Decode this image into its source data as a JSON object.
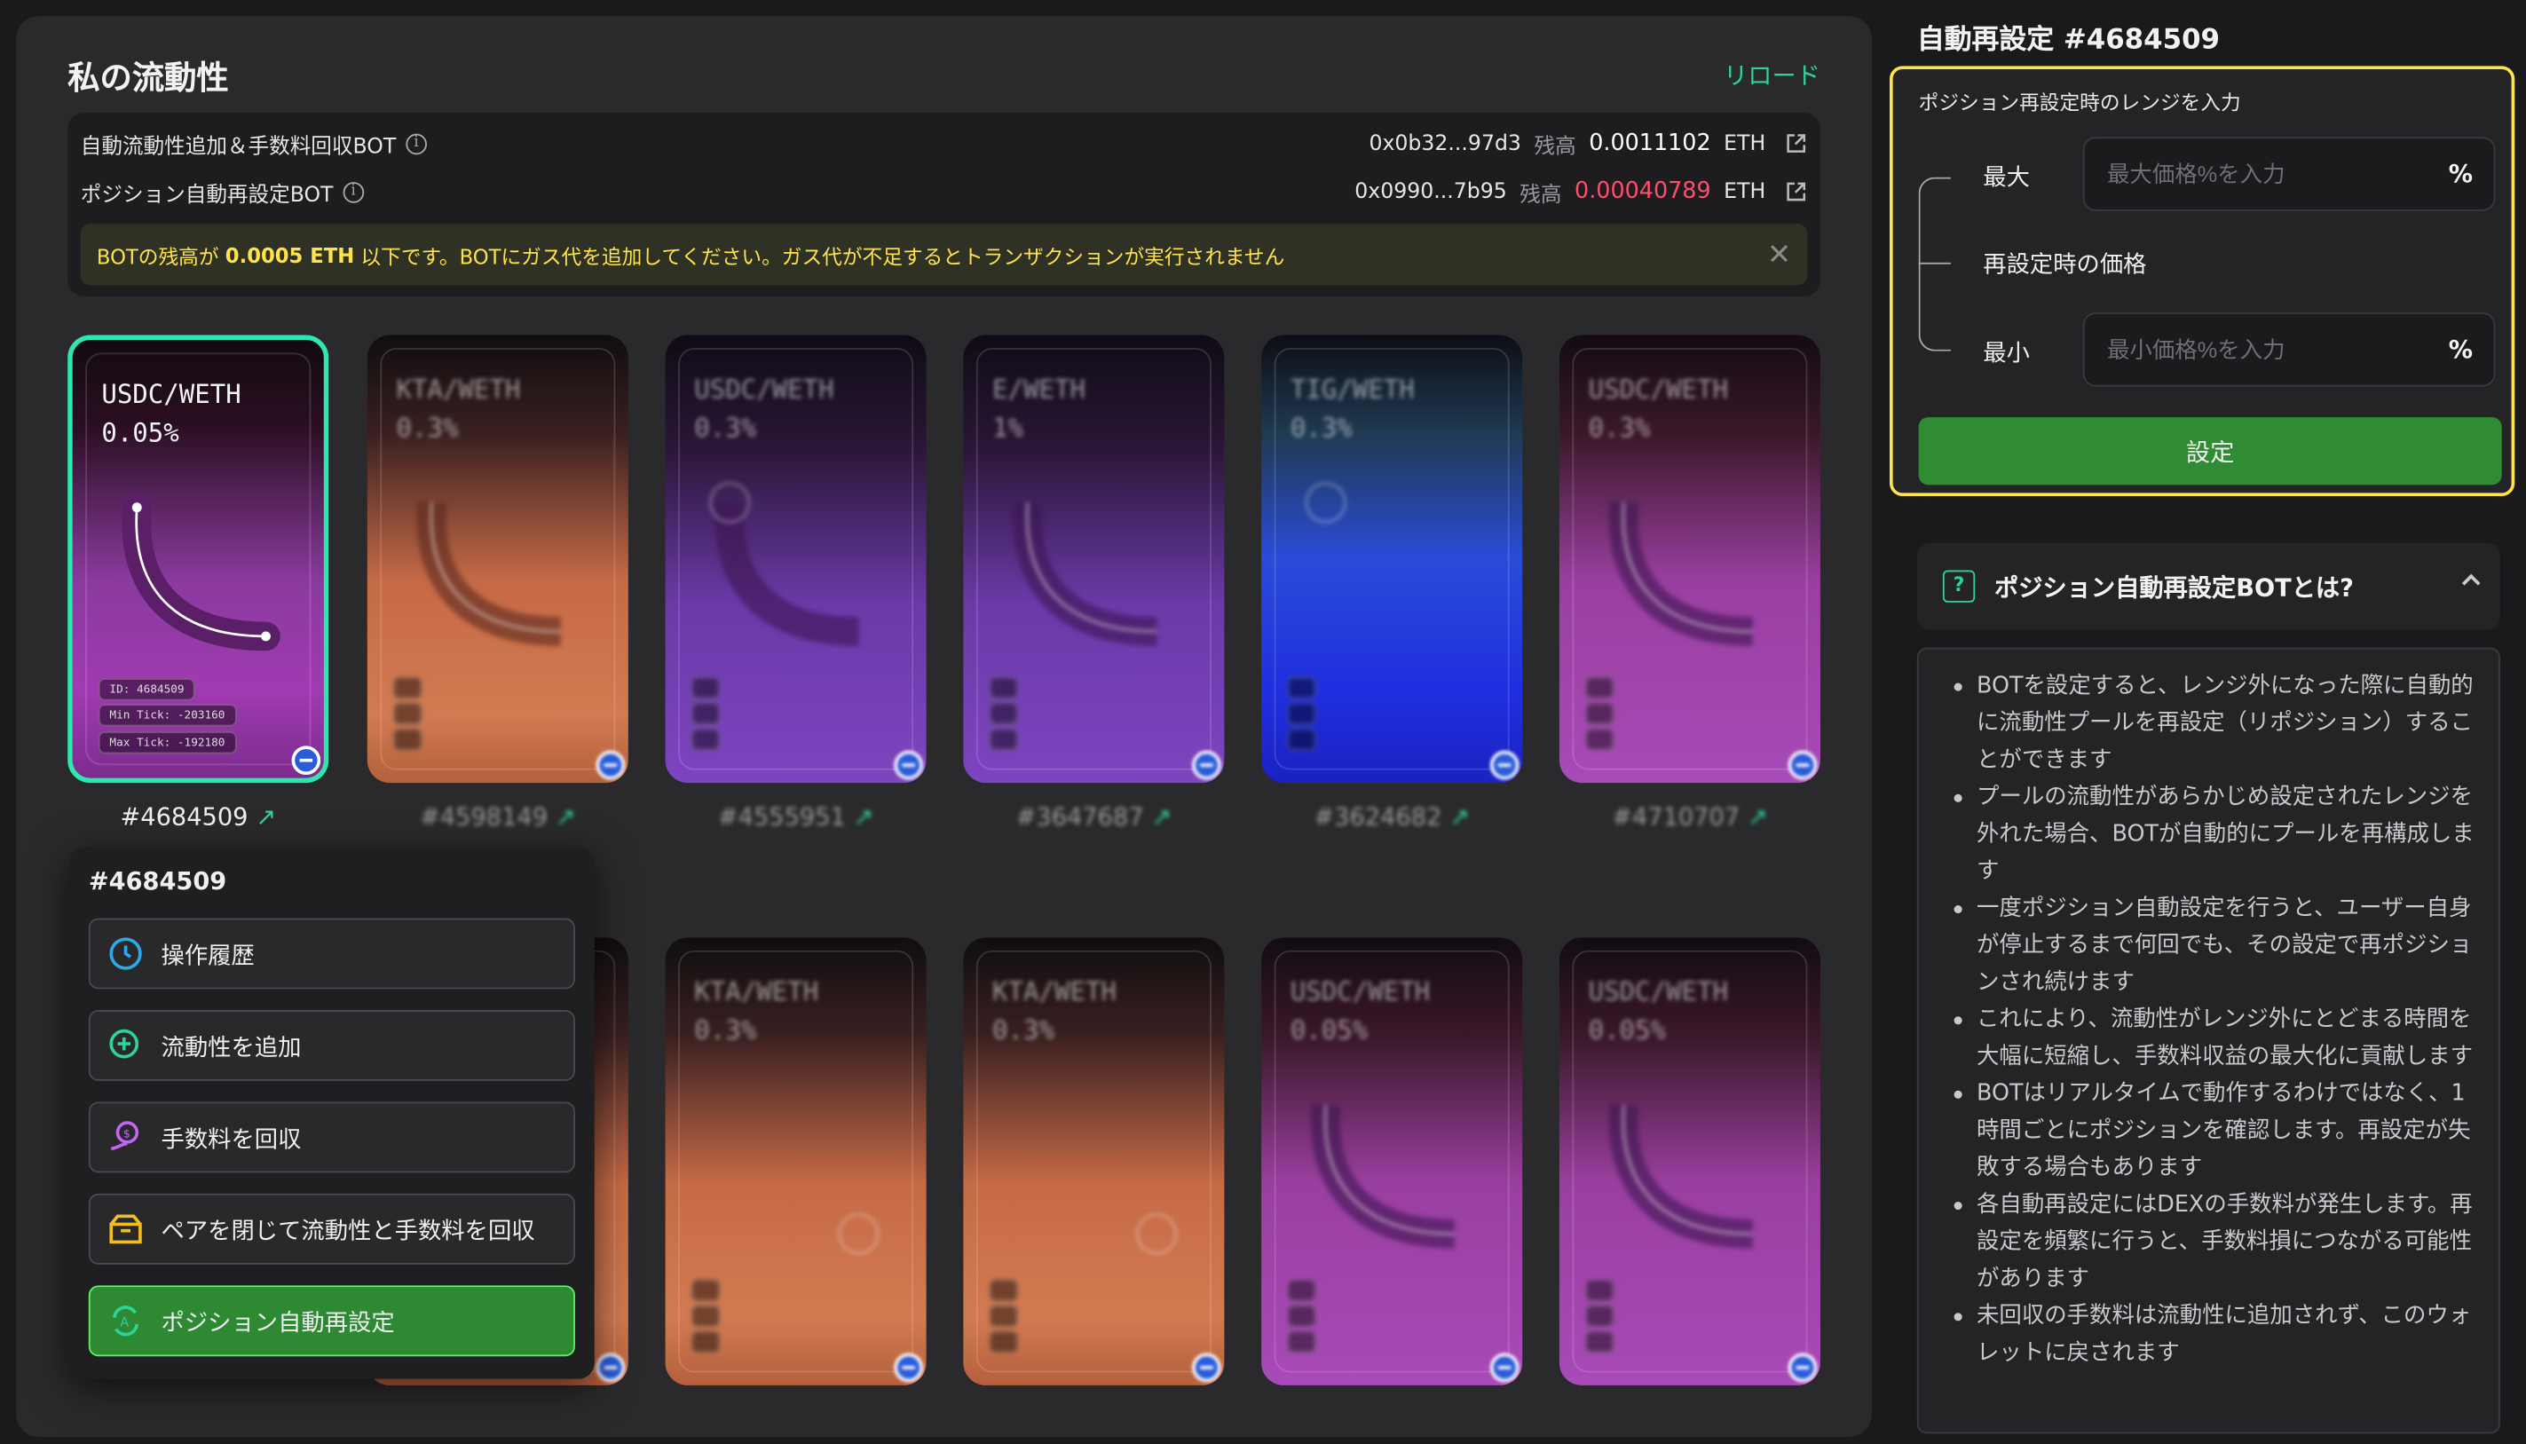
{
  "left": {
    "title": "私の流動性",
    "reload": "リロード",
    "bot1": {
      "label": "自動流動性追加＆手数料回収BOT",
      "address": "0x0b32...97d3",
      "balance_label": "残高",
      "balance": "0.0011102",
      "unit": "ETH"
    },
    "bot2": {
      "label": "ポジション自動再設定BOT",
      "address": "0x0990...7b95",
      "balance_label": "残高",
      "balance": "0.00040789",
      "unit": "ETH"
    },
    "warning": {
      "pre": "BOTの残高が",
      "amount": "0.0005 ETH",
      "post": "以下です。BOTにガス代を追加してください。ガス代が不足するとトランザクションが実行されません"
    }
  },
  "cards": [
    {
      "pair": "USDC/WETH",
      "fee": "0.05%",
      "label": "#4684509",
      "id": "ID: 4684509",
      "min_tick": "Min Tick: -203160",
      "max_tick": "Max Tick: -192180"
    },
    {
      "pair": "KTA/WETH",
      "fee": "0.3%",
      "label": "#4598149"
    },
    {
      "pair": "USDC/WETH",
      "fee": "0.3%",
      "label": "#4555951"
    },
    {
      "pair": "E/WETH",
      "fee": "1%",
      "label": "#3647687"
    },
    {
      "pair": "TIG/WETH",
      "fee": "0.3%",
      "label": "#3624682"
    },
    {
      "pair": "USDC/WETH",
      "fee": "0.3%",
      "label": "#4710707"
    },
    {
      "pair": "KTA/WETH",
      "fee": "0.3%"
    },
    {
      "pair": "KTA/WETH",
      "fee": "0.3%"
    },
    {
      "pair": "USDC/WETH",
      "fee": "0.05%"
    },
    {
      "pair": "USDC/WETH",
      "fee": "0.05%"
    }
  ],
  "menu": {
    "title": "#4684509",
    "items": [
      "操作履歴",
      "流動性を追加",
      "手数料を回収",
      "ペアを閉じて流動性と手数料を回収",
      "ポジション自動再設定"
    ]
  },
  "right": {
    "title": "自動再設定 #4684509",
    "range_label": "ポジション再設定時のレンジを入力",
    "max_label": "最大",
    "max_placeholder": "最大価格%を入力",
    "mid_label": "再設定時の価格",
    "min_label": "最小",
    "min_placeholder": "最小価格%を入力",
    "pct": "%",
    "set_button": "設定",
    "faq_title": "ポジション自動再設定BOTとは?",
    "faq_items": [
      "BOTを設定すると、レンジ外になった際に自動的に流動性プールを再設定（リポジション）することができます",
      "プールの流動性があらかじめ設定されたレンジを外れた場合、BOTが自動的にプールを再構成します",
      "一度ポジション自動設定を行うと、ユーザー自身が停止するまで何回でも、その設定で再ポジションされ続けます",
      "これにより、流動性がレンジ外にとどまる時間を大幅に短縮し、手数料収益の最大化に貢献します",
      "BOTはリアルタイムで動作するわけではなく、1時間ごとにポジションを確認します。再設定が失敗する場合もあります",
      "各自動再設定にはDEXの手数料が発生します。再設定を頻繁に行うと、手数料損につながる可能性があります",
      "未回収の手数料は流動性に追加されず、このウォレットに戻されます"
    ]
  },
  "colors": {
    "accent": "#2ed39a",
    "warning": "#ffe34d",
    "danger": "#ff4d6a",
    "primary_button": "#2f8c33"
  }
}
